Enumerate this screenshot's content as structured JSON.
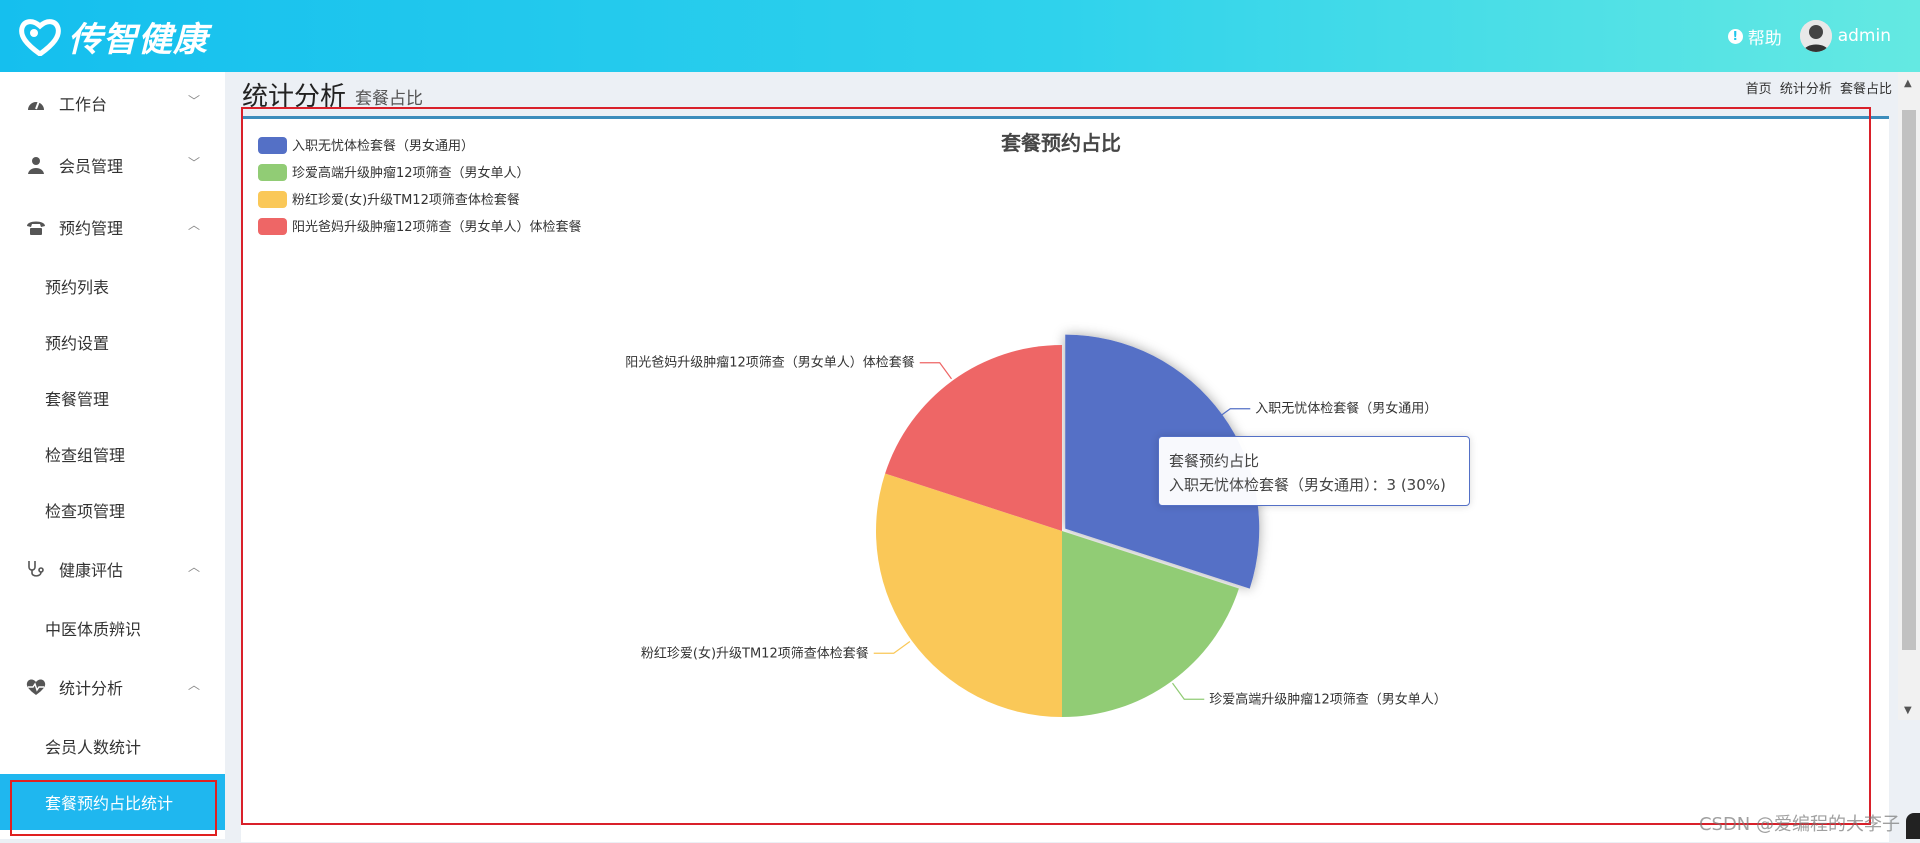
{
  "header": {
    "logo_text": "传智健康",
    "help_label": "帮助",
    "user_name": "admin",
    "brand_gradient": [
      "#15bfee",
      "#64e9e2"
    ]
  },
  "sidebar": {
    "groups": [
      {
        "label": "工作台",
        "icon": "dashboard-icon",
        "expanded": false
      },
      {
        "label": "会员管理",
        "icon": "user-icon",
        "expanded": false
      },
      {
        "label": "预约管理",
        "icon": "phone-icon",
        "expanded": true,
        "items": [
          "预约列表",
          "预约设置",
          "套餐管理",
          "检查组管理",
          "检查项管理"
        ]
      },
      {
        "label": "健康评估",
        "icon": "stethoscope-icon",
        "expanded": true,
        "items": [
          "中医体质辨识"
        ]
      },
      {
        "label": "统计分析",
        "icon": "heartbeat-icon",
        "expanded": true,
        "items": [
          "会员人数统计",
          "套餐预约占比统计"
        ]
      }
    ],
    "active_item": "套餐预约占比统计",
    "active_color": "#1fb7ef"
  },
  "page": {
    "title": "统计分析",
    "subtitle": "套餐占比",
    "breadcrumb": [
      "首页",
      "统计分析",
      "套餐占比"
    ]
  },
  "chart_data": {
    "type": "pie",
    "title": "套餐预约占比",
    "legend_position": "top-left",
    "slices": [
      {
        "name": "入职无忧体检套餐（男女通用）",
        "value": 3,
        "percent": 30,
        "color": "#5470c6"
      },
      {
        "name": "珍爱高端升级肿瘤12项筛查（男女单人）",
        "value": 2,
        "percent": 20,
        "color": "#91cc75"
      },
      {
        "name": "粉红珍爱(女)升级TM12项筛查体检套餐",
        "value": 3,
        "percent": 30,
        "color": "#fac858"
      },
      {
        "name": "阳光爸妈升级肿瘤12项筛查（男女单人）体检套餐",
        "value": 2,
        "percent": 20,
        "color": "#ee6666"
      }
    ],
    "highlighted_slice": 0
  },
  "tooltip": {
    "title": "套餐预约占比",
    "line": "入职无忧体检套餐（男女通用）：3 (30%)"
  },
  "watermark": "CSDN @爱编程的大李子"
}
